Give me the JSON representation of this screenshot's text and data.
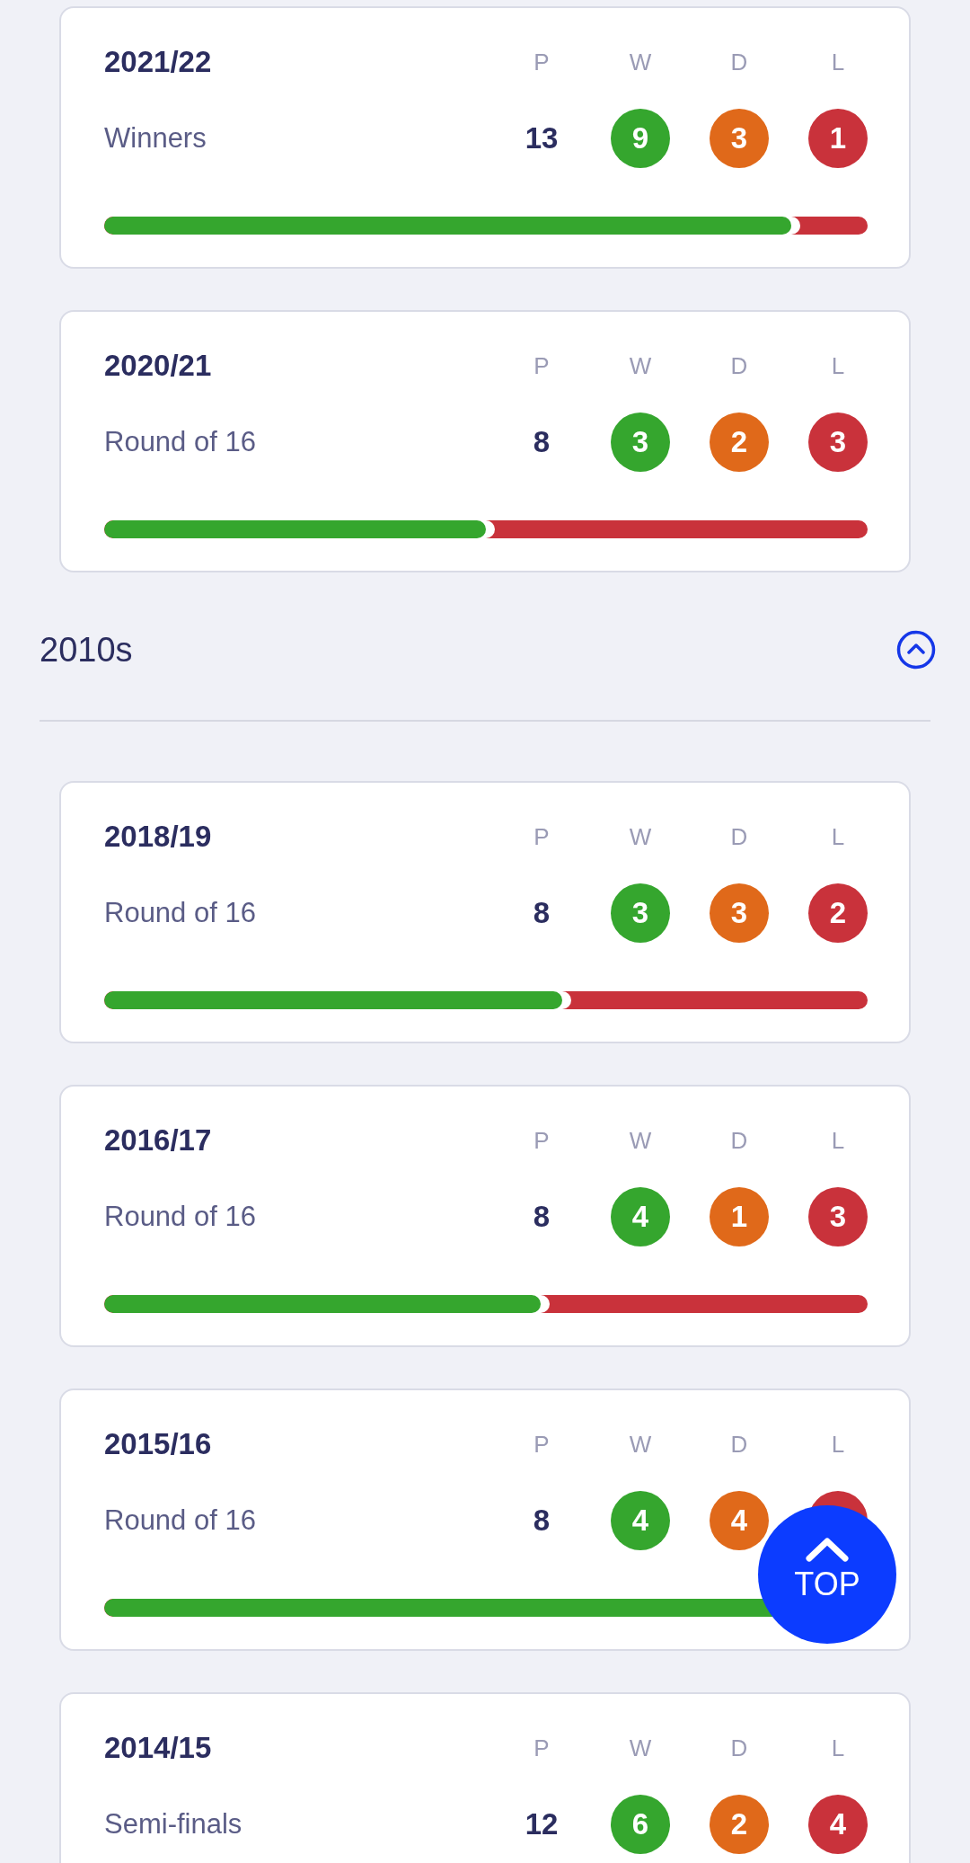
{
  "cards_above": [
    {
      "season": "2021/22",
      "result": "Winners",
      "column_labels": [
        "P",
        "W",
        "D",
        "L"
      ],
      "played": "13",
      "won": "9",
      "drawn": "3",
      "lost": "1",
      "level": 0.9
    },
    {
      "season": "2020/21",
      "result": "Round of 16",
      "column_labels": [
        "P",
        "W",
        "D",
        "L"
      ],
      "played": "8",
      "won": "3",
      "drawn": "2",
      "lost": "3",
      "level": 0.5
    }
  ],
  "section": {
    "title": "2010s",
    "expanded": true,
    "cards": [
      {
        "season": "2018/19",
        "result": "Round of 16",
        "column_labels": [
          "P",
          "W",
          "D",
          "L"
        ],
        "played": "8",
        "won": "3",
        "drawn": "3",
        "lost": "2",
        "level": 0.6
      },
      {
        "season": "2016/17",
        "result": "Round of 16",
        "column_labels": [
          "P",
          "W",
          "D",
          "L"
        ],
        "played": "8",
        "won": "4",
        "drawn": "1",
        "lost": "3",
        "level": 0.5714
      },
      {
        "season": "2015/16",
        "result": "Round of 16",
        "column_labels": [
          "P",
          "W",
          "D",
          "L"
        ],
        "played": "8",
        "won": "4",
        "drawn": "4",
        "level": 1
      },
      {
        "season": "2014/15",
        "result": "Semi-finals",
        "column_labels": [
          "P",
          "W",
          "D",
          "L"
        ],
        "played": "12",
        "won": "6",
        "drawn": "2",
        "lost": "4"
      }
    ]
  },
  "top_button": {
    "label": "TOP"
  }
}
